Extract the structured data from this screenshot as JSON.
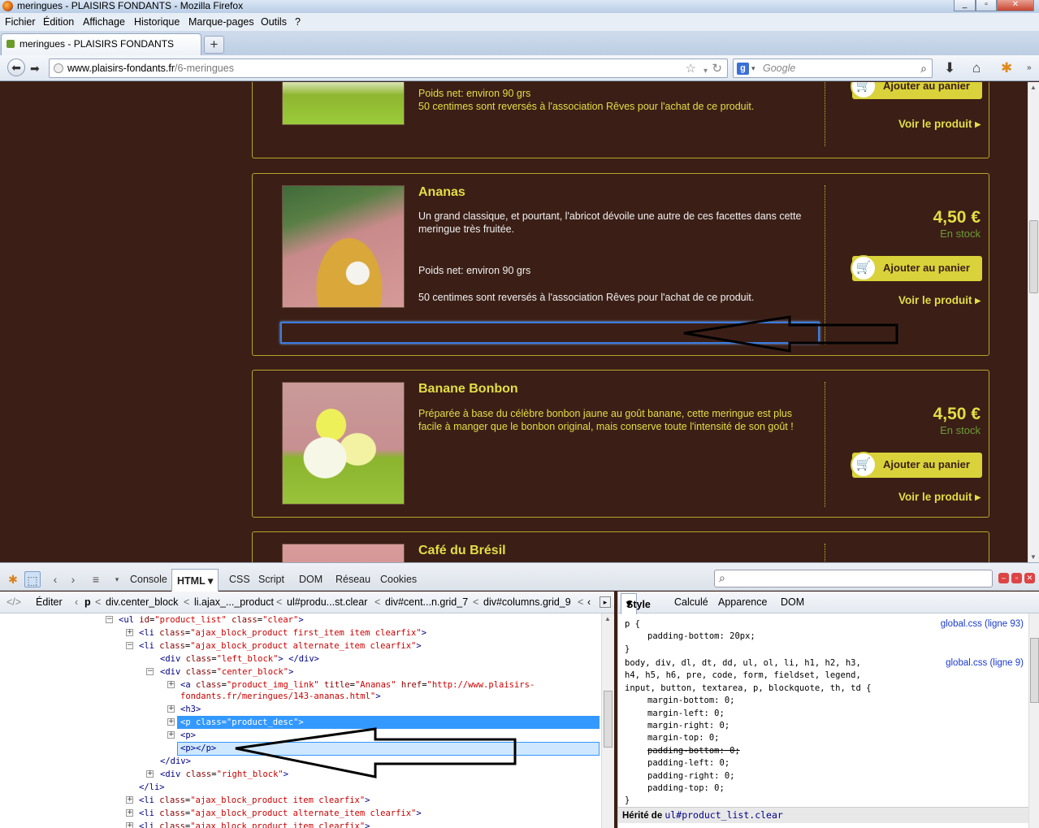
{
  "window": {
    "title": "meringues - PLAISIRS FONDANTS - Mozilla Firefox"
  },
  "menu": [
    "Fichier",
    "Édition",
    "Affichage",
    "Historique",
    "Marque-pages",
    "Outils",
    "?"
  ],
  "tab": {
    "label": "meringues - PLAISIRS FONDANTS",
    "new_tab": "+"
  },
  "url": {
    "host": "www.plaisirs-fondants.fr",
    "path": "/6-meringues"
  },
  "search": {
    "placeholder": "Google"
  },
  "products": [
    {
      "name": "",
      "desc_lines": [
        "Poids net: environ 90 grs",
        "50 centimes sont reversés à l'association Rêves pour l'achat de ce produit."
      ],
      "cart": "Ajouter au panier",
      "see": "Voir le produit"
    },
    {
      "name": "Ananas",
      "desc": "Un grand classique, et pourtant, l'abricot dévoile une autre de ces facettes dans cette meringue très fruitée.",
      "weight": "Poids net: environ 90 grs",
      "charity": "50 centimes sont reversés à l'association Rêves pour l'achat de ce produit.",
      "price": "4,50 €",
      "stock": "En stock",
      "cart": "Ajouter au panier",
      "see": "Voir le produit"
    },
    {
      "name": "Banane Bonbon",
      "desc": "Préparée à base du célèbre bonbon jaune au goût banane, cette meringue est plus facile à manger que le bonbon original, mais conserve toute l'intensité de son goût !",
      "price": "4,50 €",
      "stock": "En stock",
      "cart": "Ajouter au panier",
      "see": "Voir le produit"
    },
    {
      "name": "Café du Brésil"
    }
  ],
  "firebug": {
    "tabs": [
      "Console",
      "HTML",
      "CSS",
      "Script",
      "DOM",
      "Réseau",
      "Cookies"
    ],
    "active_tab": "HTML",
    "edit": "Éditer",
    "crumbs": [
      "p",
      "div.center_block",
      "li.ajax_..._product",
      "ul#produ...st.clear",
      "div#cent...n.grid_7",
      "div#columns.grid_9"
    ],
    "side_tabs": [
      "Style",
      "Calculé",
      "Apparence",
      "DOM"
    ],
    "active_side_tab": "Style",
    "html_lines": [
      {
        "tag": "ul",
        "attrs": "id=\"product_list\" class=\"clear\""
      },
      {
        "text": "<li class=\"ajax_block_product first_item item clearfix\">"
      },
      {
        "text": "<li class=\"ajax_block_product alternate_item clearfix\">"
      },
      {
        "text": "<div class=\"left_block\"> </div>"
      },
      {
        "text": "<div class=\"center_block\">"
      },
      {
        "text": "<a class=\"product_img_link\" title=\"Ananas\" href=\"http://www.plaisirs-"
      },
      {
        "text": "fondants.fr/meringues/143-ananas.html\">"
      },
      {
        "text": "<h3>"
      },
      {
        "text": "<p class=\"product_desc\">"
      },
      {
        "text": "<p>"
      },
      {
        "text": "<p></p>"
      },
      {
        "text": "</div>"
      },
      {
        "text": "<div class=\"right_block\">"
      },
      {
        "text": "</li>"
      },
      {
        "text": "<li class=\"ajax_block_product item clearfix\">"
      },
      {
        "text": "<li class=\"ajax_block_product alternate_item clearfix\">"
      },
      {
        "text": "<li class=\"ajax_block_product item clearfix\">"
      }
    ],
    "css_rule1": {
      "selector": "p {",
      "props": [
        "padding-bottom: 20px;"
      ],
      "close": "}",
      "source": "global.css (ligne 93)"
    },
    "css_rule2": {
      "selector_lines": [
        "body, div, dl, dt, dd, ul, ol, li, h1, h2, h3,",
        "h4, h5, h6, pre, code, form, fieldset, legend,",
        "input, button, textarea, p, blockquote, th, td {"
      ],
      "props": [
        "margin-bottom: 0;",
        "margin-left: 0;",
        "margin-right: 0;",
        "margin-top: 0;",
        "padding-bottom: 0;",
        "padding-left: 0;",
        "padding-right: 0;",
        "padding-top: 0;"
      ],
      "close": "}",
      "source": "global.css (ligne 9)"
    },
    "inherited": {
      "label": "Hérité de",
      "selector": "ul#product_list.clear"
    }
  },
  "colors": {
    "page_bg": "#3b1f16",
    "accent": "#e4dd46",
    "stock": "#6d9a3a",
    "selection": "#3399ff"
  }
}
